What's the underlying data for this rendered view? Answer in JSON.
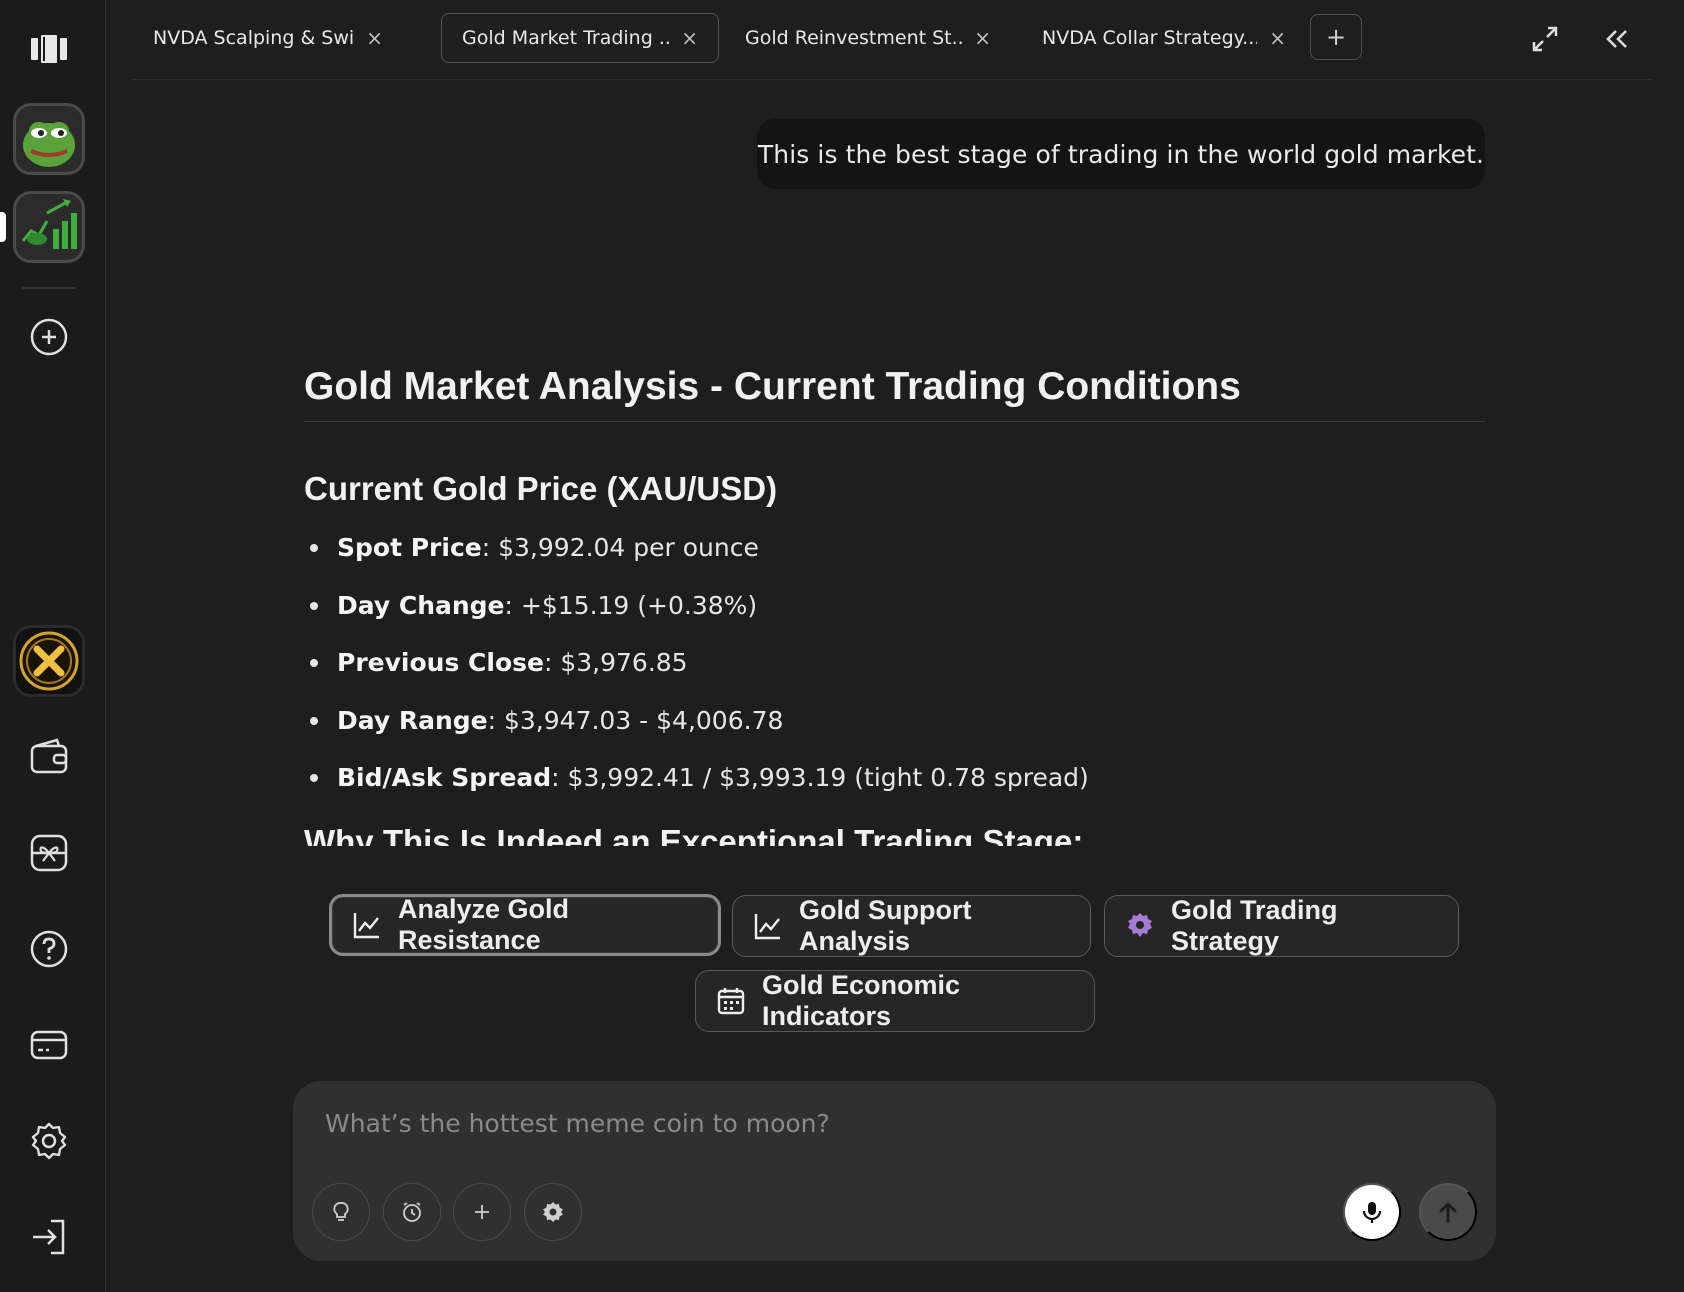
{
  "tabs": [
    {
      "label": "NVDA Scalping & Swin...",
      "close": "×"
    },
    {
      "label": "Gold Market Trading ...",
      "close": "×",
      "active": true
    },
    {
      "label": "Gold Reinvestment St...",
      "close": "×"
    },
    {
      "label": "NVDA Collar Strategy...",
      "close": "×"
    }
  ],
  "tab_add": "+",
  "user_message": "This is the best stage of trading in the world gold market.",
  "response": {
    "title": "Gold Market Analysis - Current Trading Conditions",
    "section_title": "Current Gold Price (XAU/USD)",
    "items": [
      {
        "label": "Spot Price",
        "value": ": $3,992.04 per ounce"
      },
      {
        "label": "Day Change",
        "value": ": +$15.19 (+0.38%)"
      },
      {
        "label": "Previous Close",
        "value": ": $3,976.85"
      },
      {
        "label": "Day Range",
        "value": ": $3,947.03 - $4,006.78"
      },
      {
        "label": "Bid/Ask Spread",
        "value": ": $3,992.41 / $3,993.19 (tight 0.78 spread)"
      }
    ],
    "next_section_title": "Why This Is Indeed an Exceptional Trading Stage:"
  },
  "suggestions": [
    {
      "label": "Analyze Gold Resistance",
      "icon": "chart-line-icon"
    },
    {
      "label": "Gold Support Analysis",
      "icon": "chart-line-icon"
    },
    {
      "label": "Gold Trading Strategy",
      "icon": "gear-icon"
    },
    {
      "label": "Gold Economic Indicators",
      "icon": "calendar-icon"
    }
  ],
  "composer": {
    "placeholder": "What’s the hottest meme coin to moon?"
  },
  "colors": {
    "background": "#1e1e1e",
    "sidebar": "#1b1b1b",
    "bubble": "#141414",
    "composer": "#303030",
    "gear_accent": "#a77bd6",
    "chart_green": "#3fae3f"
  }
}
